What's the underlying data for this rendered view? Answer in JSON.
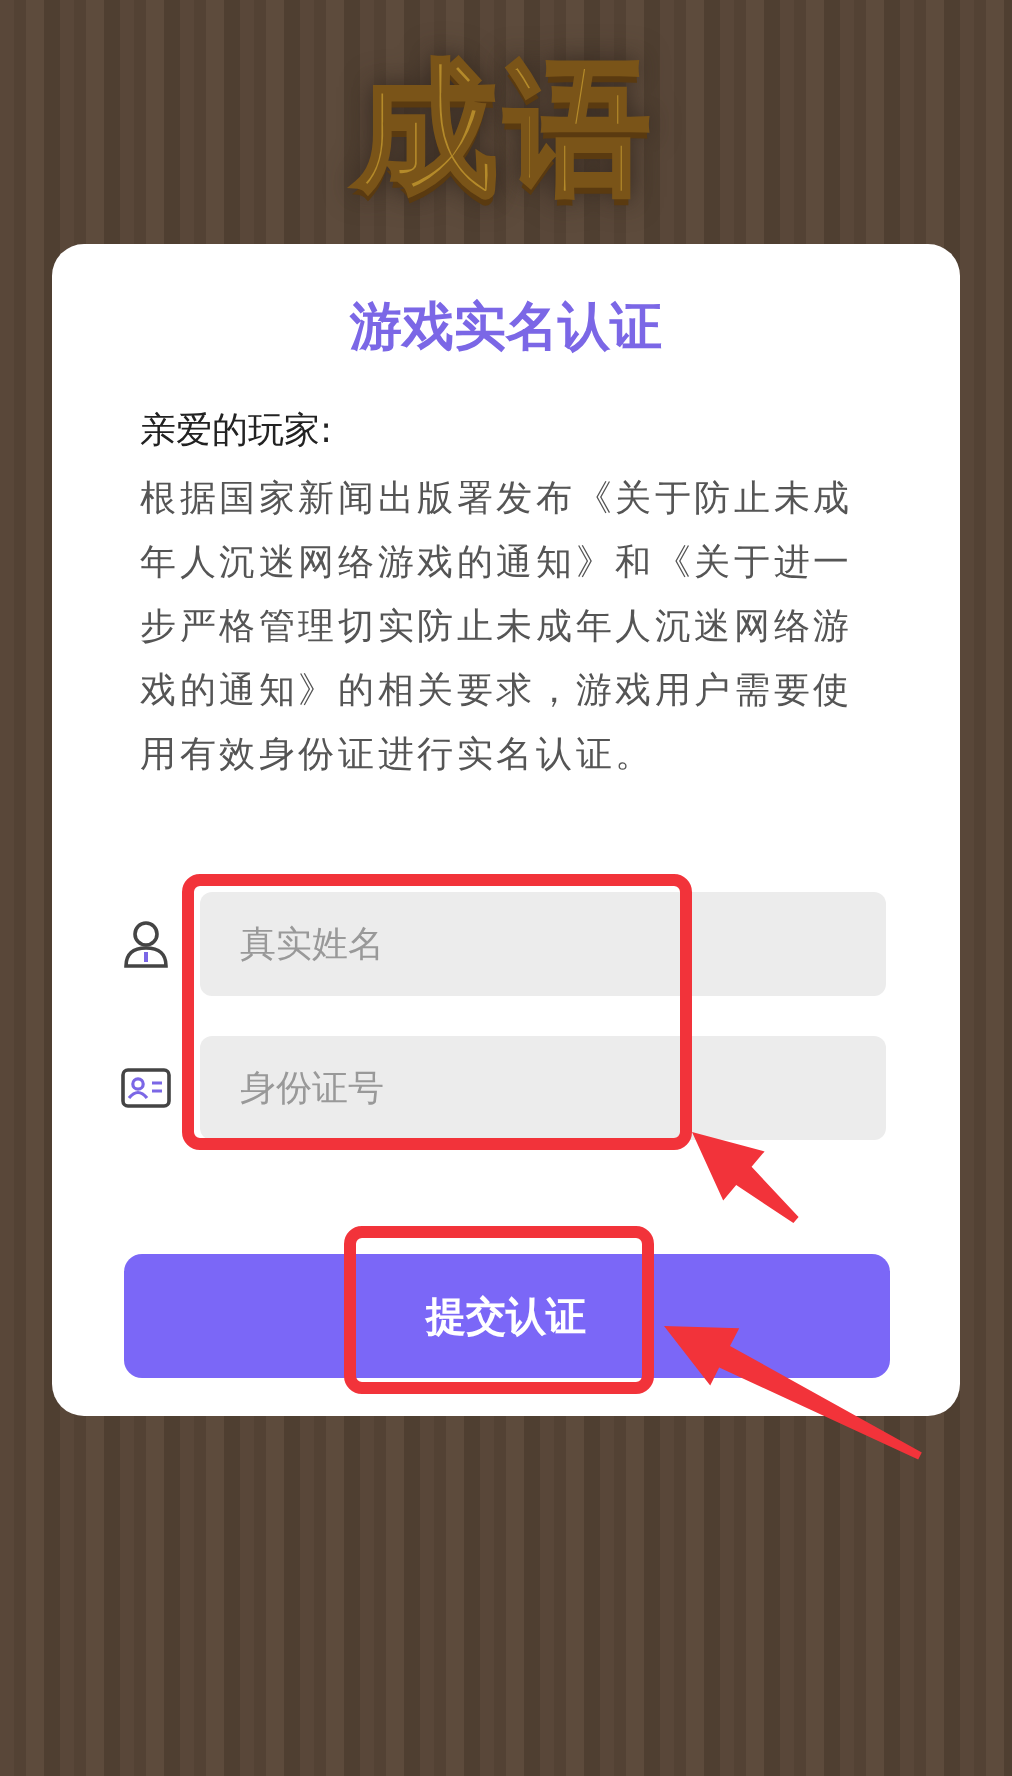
{
  "logo": {
    "text": "成语"
  },
  "dialog": {
    "title": "游戏实名认证",
    "greeting": "亲爱的玩家:",
    "message": "根据国家新闻出版署发布《关于防止未成年人沉迷网络游戏的通知》和《关于进一步严格管理切实防止未成年人沉迷网络游戏的通知》的相关要求，游戏用户需要使用有效身份证进行实名认证。",
    "fields": [
      {
        "kind": "name",
        "placeholder": "真实姓名"
      },
      {
        "kind": "id",
        "placeholder": "身份证号"
      }
    ],
    "submit": {
      "label": "提交认证"
    }
  },
  "annotations": [
    {
      "kind": "frame"
    },
    {
      "kind": "arrow"
    },
    {
      "kind": "frame"
    },
    {
      "kind": "arrow"
    }
  ]
}
